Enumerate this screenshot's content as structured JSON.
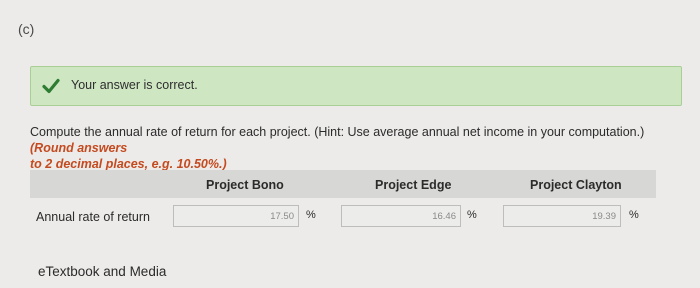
{
  "part_label": "(c)",
  "alert": {
    "message": "Your answer is correct.",
    "icon": "checkmark-icon",
    "accent_color": "#2e7d32"
  },
  "prompt": {
    "text": "Compute the annual rate of return for each project. (Hint: Use average annual net income in your computation.)",
    "round_prefix": "(Round answers",
    "round_suffix": "to 2 decimal places, e.g. 10.50%.)"
  },
  "table": {
    "columns": [
      "Project Bono",
      "Project Edge",
      "Project Clayton"
    ],
    "row_label": "Annual rate of return",
    "values": [
      "17.50",
      "16.46",
      "19.39"
    ],
    "unit": "%"
  },
  "footer_link": "eTextbook and Media"
}
